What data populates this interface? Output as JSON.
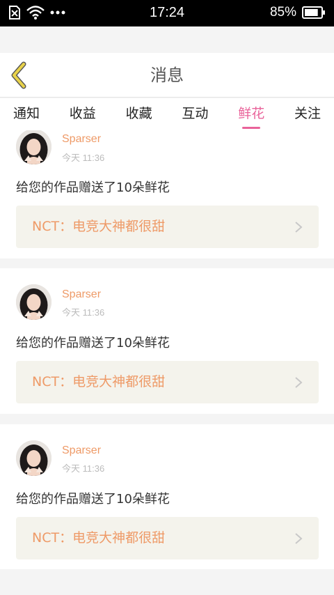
{
  "status_bar": {
    "time": "17:24",
    "battery_percent": "85%",
    "icons": [
      "no-sim-icon",
      "wifi-icon",
      "more-dots-icon",
      "battery-icon"
    ],
    "battery_level": 0.85
  },
  "header": {
    "title": "消息",
    "back_icon": "chevron-left-icon"
  },
  "tabs": [
    {
      "label": "通知",
      "active": false
    },
    {
      "label": "收益",
      "active": false
    },
    {
      "label": "收藏",
      "active": false
    },
    {
      "label": "互动",
      "active": false
    },
    {
      "label": "鲜花",
      "active": true
    },
    {
      "label": "关注",
      "active": false
    }
  ],
  "colors": {
    "accent_pink": "#e9639a",
    "accent_orange": "#ee9a67",
    "back_icon_yellow": "#e8d24a"
  },
  "messages": [
    {
      "sender": "Sparser",
      "time": "今天 11:36",
      "text": "给您的作品赠送了10朵鲜花",
      "work_title": "NCT：电竞大神都很甜"
    },
    {
      "sender": "Sparser",
      "time": "今天 11:36",
      "text": "给您的作品赠送了10朵鲜花",
      "work_title": "NCT：电竞大神都很甜"
    },
    {
      "sender": "Sparser",
      "time": "今天 11:36",
      "text": "给您的作品赠送了10朵鲜花",
      "work_title": "NCT：电竞大神都很甜"
    }
  ]
}
